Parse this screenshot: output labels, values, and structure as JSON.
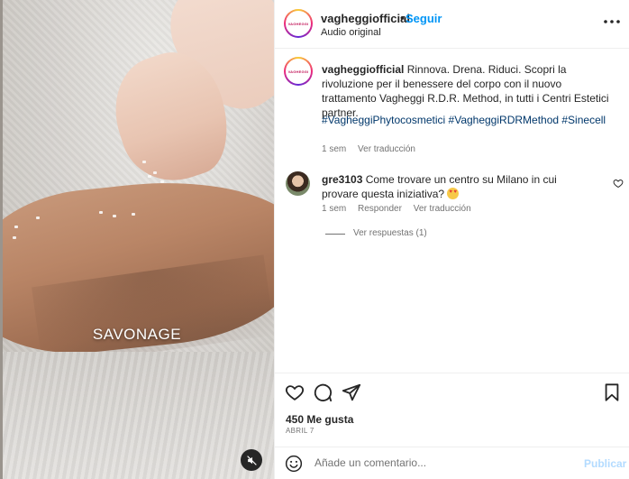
{
  "post": {
    "username": "vagheggiofficial",
    "separator": "•",
    "follow_label": "Seguir",
    "audio_label": "Audio original",
    "more_icon": "more-horizontal-icon",
    "avatar_text": "VAGHEGGI",
    "media": {
      "overlay_text": "SAVONAGE",
      "mute_icon": "muted-speaker-icon"
    }
  },
  "caption": {
    "username": "vagheggiofficial",
    "text": "Rinnova. Drena. Riduci. Scopri la rivoluzione per il benessere del corpo con il nuovo trattamento Vagheggi R.D.R. Method, in tutti i Centri Estetici partner.",
    "hashtags": "#VagheggiPhytocosmetici #VagheggiRDRMethod #Sinecell",
    "time": "1 sem",
    "translate_label": "Ver traducción"
  },
  "comments": [
    {
      "username": "gre3103",
      "text": "Come trovare un centro su Milano in cui provare questa iniziativa?",
      "time": "1 sem",
      "reply_label": "Responder",
      "translate_label": "Ver traducción",
      "replies_label": "Ver respuestas (1)"
    }
  ],
  "footer": {
    "likes": "450 Me gusta",
    "date": "ABRIL 7",
    "comment_placeholder": "Añade un comentario...",
    "publish_label": "Publicar"
  },
  "colors": {
    "link_blue": "#0095f6",
    "hashtag_blue": "#00376b",
    "secondary_text": "#737373",
    "publish_disabled": "#b3dbff"
  }
}
